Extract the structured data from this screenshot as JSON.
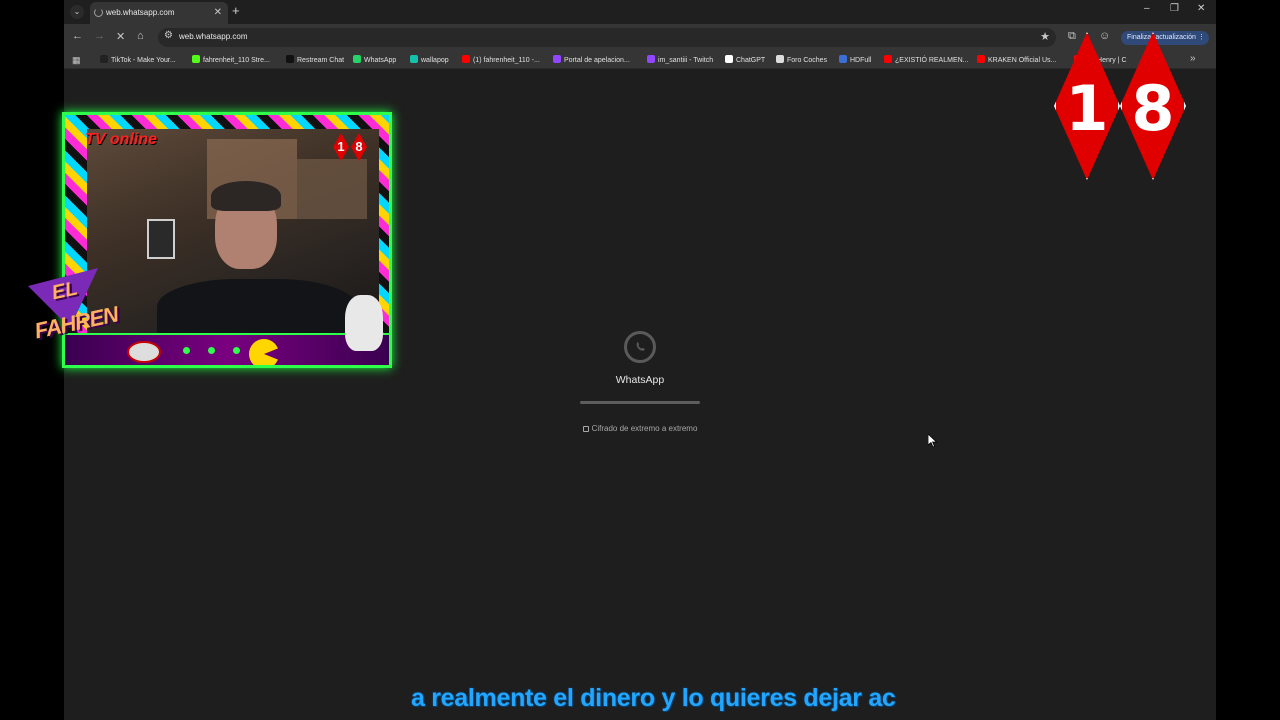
{
  "browser": {
    "tab_title": "web.whatsapp.com",
    "url": "web.whatsapp.com",
    "update_button": "Finalizar actualización",
    "bookmarks": [
      {
        "label": "TikTok - Make Your...",
        "color": "#222222"
      },
      {
        "label": "fahrenheit_110 Stre...",
        "color": "#53fc18"
      },
      {
        "label": "Restream Chat",
        "color": "#111111"
      },
      {
        "label": "WhatsApp",
        "color": "#25d366"
      },
      {
        "label": "wallapop",
        "color": "#13c1ac"
      },
      {
        "label": "(1) fahrenheit_110 -...",
        "color": "#ff0000"
      },
      {
        "label": "Portal de apelacion...",
        "color": "#9146ff"
      },
      {
        "label": "im_santiii - Twitch",
        "color": "#9146ff"
      },
      {
        "label": "ChatGPT",
        "color": "#ffffff"
      },
      {
        "label": "Foro Coches",
        "color": "#dddddd"
      },
      {
        "label": "HDFull",
        "color": "#3b6fd6"
      },
      {
        "label": "¿EXISTIÓ REALMEN...",
        "color": "#ff0000"
      },
      {
        "label": "KRAKEN Official Us...",
        "color": "#ff0000"
      },
      {
        "label": "ore Henry | C",
        "color": "#ff0000"
      }
    ]
  },
  "whatsapp": {
    "title": "WhatsApp",
    "encryption": "Cifrado de extremo a extremo",
    "progress": 1.0
  },
  "overlay": {
    "webcam_badge": "TV online",
    "webcam_18": [
      "1",
      "8"
    ],
    "el": "EL",
    "fahren": "FAHREN",
    "big18": [
      "1",
      "8"
    ],
    "subtitle": "a realmente el dinero y lo quieres dejar ac"
  }
}
